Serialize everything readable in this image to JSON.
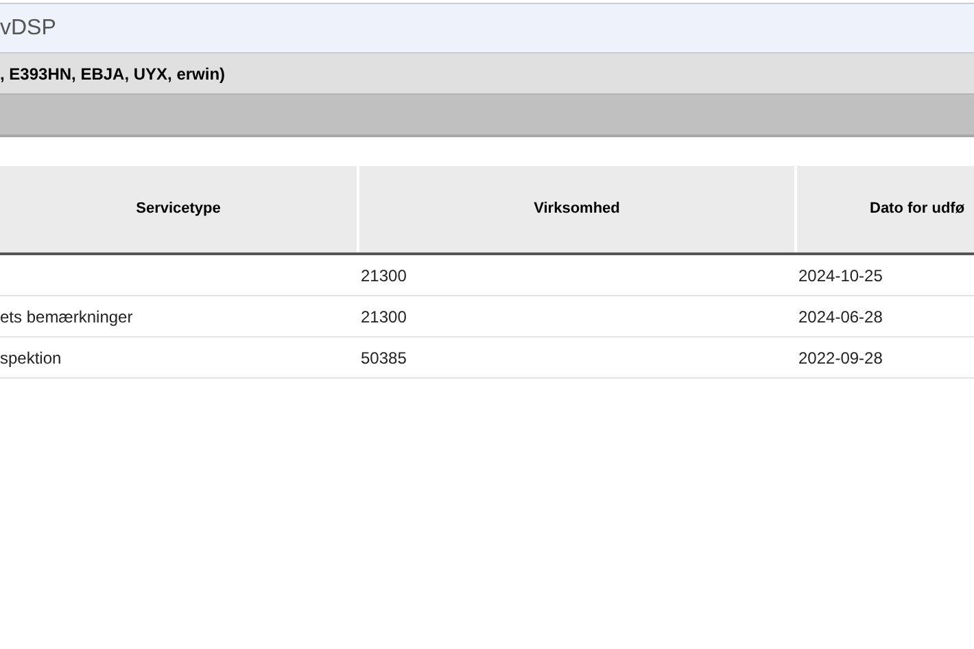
{
  "title_bar": {
    "title": "vDSP"
  },
  "info_bar": {
    "text": ", E393HN, EBJA, UYX, erwin)"
  },
  "table": {
    "columns": [
      "Servicetype",
      "Virksomhed",
      "Dato for udfø"
    ],
    "rows": [
      {
        "cells": [
          "",
          "21300",
          "2024-10-25"
        ]
      },
      {
        "cells": [
          "ets bemærkninger",
          "21300",
          "2024-06-28"
        ]
      },
      {
        "cells": [
          "spektion",
          "50385",
          "2022-09-28"
        ]
      }
    ]
  }
}
